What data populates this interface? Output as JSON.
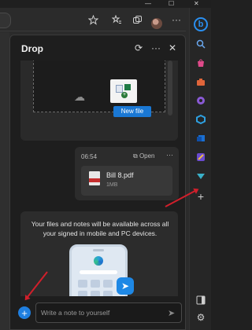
{
  "window": {
    "minimize": "—",
    "maximize": "☐",
    "close": "✕"
  },
  "toolbar": {
    "icons": [
      "home-icon",
      "star-add-icon",
      "favorites-icon",
      "collections-icon",
      "profile-avatar",
      "more-icon"
    ]
  },
  "drop": {
    "title": "Drop",
    "new_file_label": "New file",
    "file_message": {
      "time": "06:54",
      "open_label": "Open",
      "file_name": "Bill 8.pdf",
      "file_size": "1MB"
    },
    "info_text": "Your files and notes will be available across all your signed in mobile and PC devices.",
    "composer": {
      "placeholder": "Write a note to yourself"
    }
  },
  "sidebar": {
    "icons": [
      "copilot-icon",
      "search-icon",
      "shopping-icon",
      "tools-icon",
      "games-icon",
      "office-icon",
      "outlook-icon",
      "designer-icon",
      "drop-icon",
      "add-icon",
      "layout-icon",
      "settings-icon"
    ]
  },
  "colors": {
    "accent": "#1f7fe0",
    "annotation": "#d11f2b",
    "panel_bg": "#1e1e1e"
  }
}
